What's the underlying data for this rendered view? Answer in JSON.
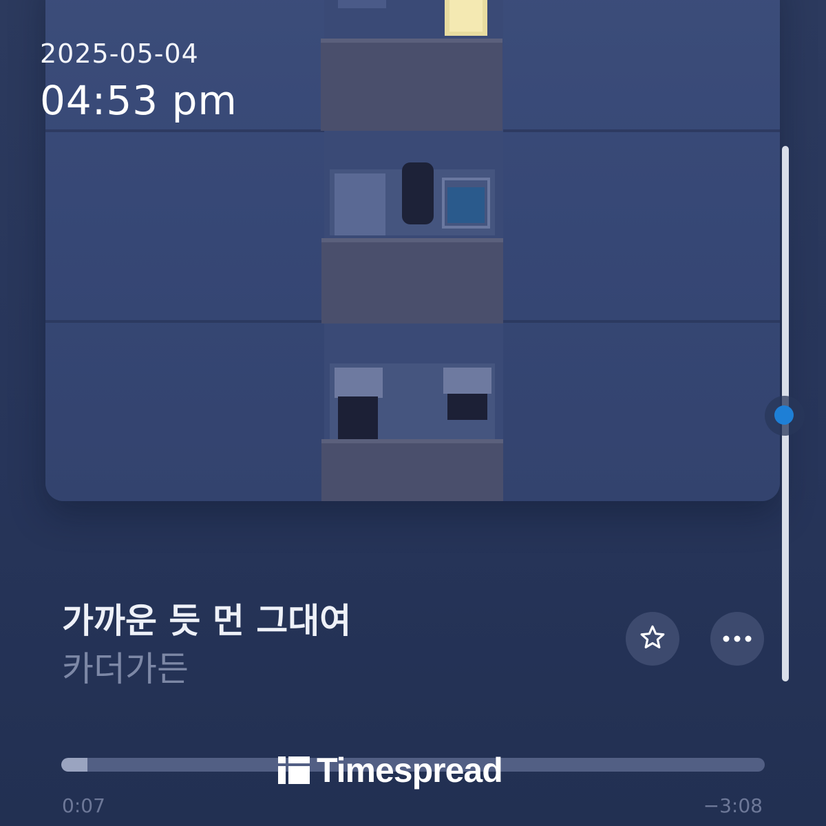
{
  "status": {
    "date": "2025-05-04",
    "time": "04:53 pm"
  },
  "track": {
    "title": "가까운 듯 먼 그대여",
    "artist": "카더가든"
  },
  "playback": {
    "elapsed": "0:07",
    "remaining": "−3:08",
    "progress_fraction": 0.037
  },
  "watermark": {
    "brand": "Timespread"
  },
  "icons": {
    "favorite": "star-outline-icon",
    "more": "ellipsis-icon",
    "brand": "timespread-logo-icon"
  },
  "colors": {
    "background": "#27355a",
    "scroll_thumb": "#1e7fd6",
    "artist_text": "#7d88a6"
  }
}
